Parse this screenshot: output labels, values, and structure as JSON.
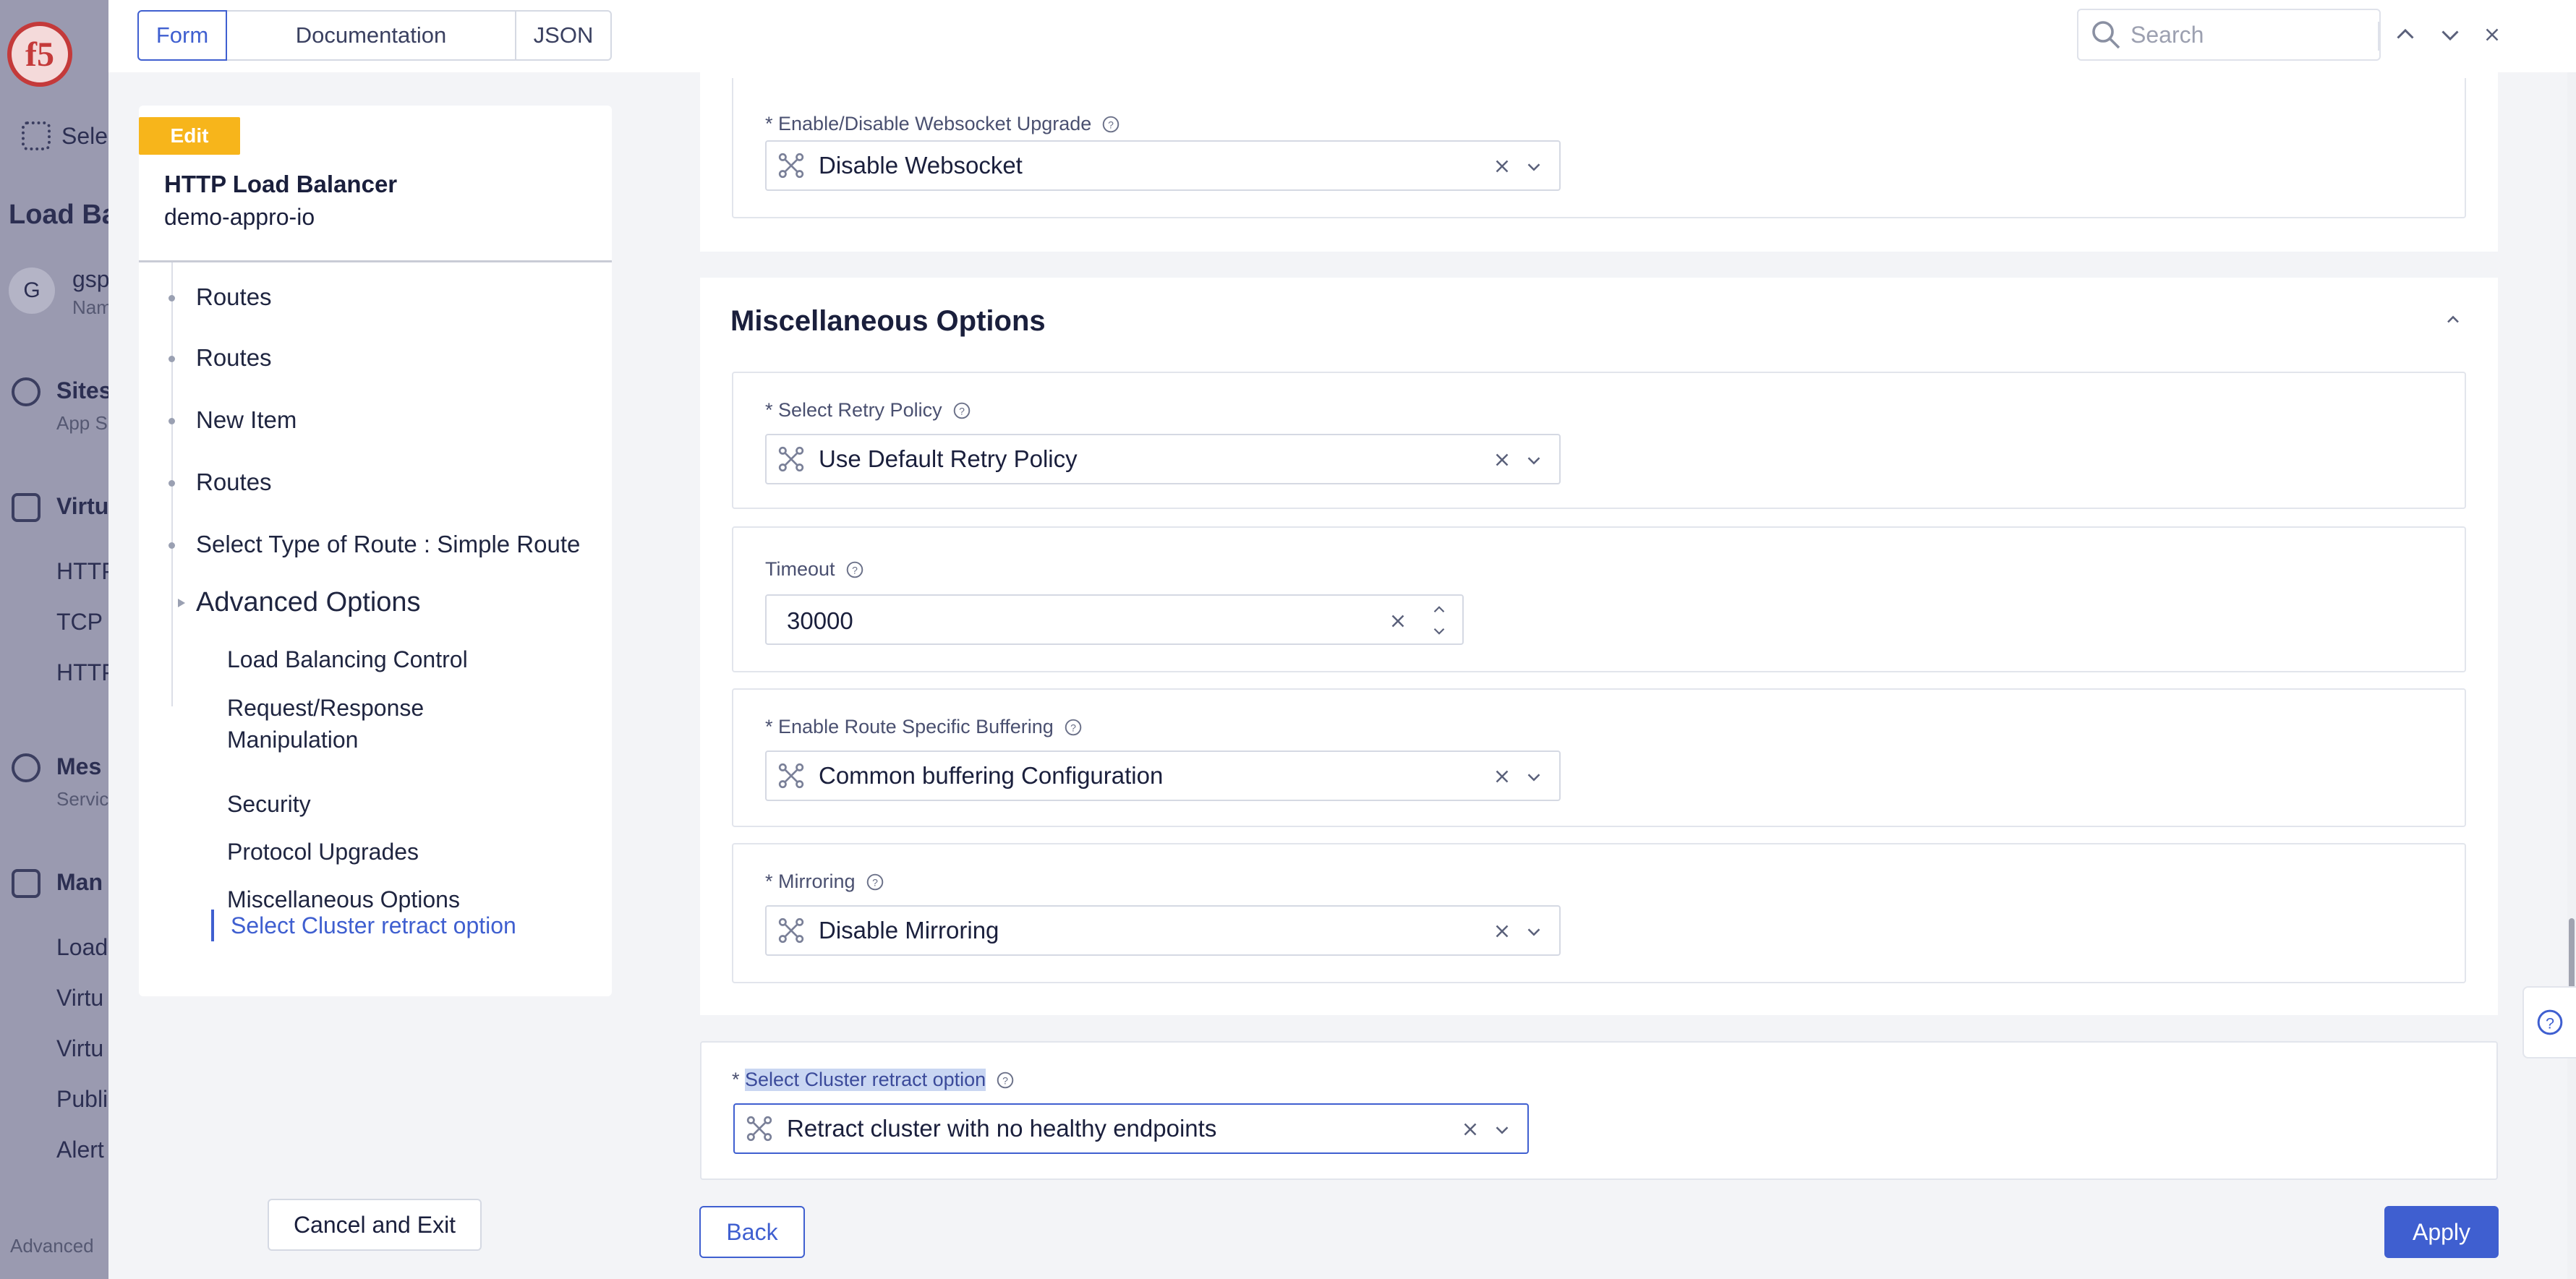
{
  "background": {
    "logo_text": "f5",
    "select_label": "Sele",
    "load_label": "Load Ba",
    "avatar_letter": "G",
    "user_label": "gsp",
    "namespace_label": "Nam",
    "sites_label": "Sites",
    "sites_sub": "App S",
    "virtual_label": "Virtu",
    "http_label": "HTTP",
    "tcp_label": "TCP",
    "https_label": "HTTP",
    "mesh_label": "Mes",
    "mesh_sub": "Servic",
    "manage_label": "Man",
    "load2_label": "Load",
    "virt2_label": "Virtu",
    "virt3_label": "Virtu",
    "public_label": "Publi",
    "alert_label": "Alert",
    "advanced_label": "Advanced"
  },
  "topbar": {
    "tabs": [
      "Form",
      "Documentation",
      "JSON"
    ],
    "search_placeholder": "Search"
  },
  "nav": {
    "badge": "Edit",
    "title": "HTTP Load Balancer",
    "subtitle": "demo-appro-io",
    "tree": [
      "Routes",
      "Routes",
      "New Item",
      "Routes",
      "Select Type of Route : Simple Route",
      "Advanced Options"
    ],
    "sub_items": [
      "Load Balancing Control",
      "Request/Response Manipulation",
      "Security",
      "Protocol Upgrades",
      "Miscellaneous Options",
      "Select Cluster retract option"
    ],
    "cancel_label": "Cancel and Exit"
  },
  "form": {
    "websocket": {
      "label": "* Enable/Disable Websocket Upgrade",
      "value": "Disable Websocket"
    },
    "misc_title": "Miscellaneous Options",
    "retry": {
      "label": "* Select Retry Policy",
      "value": "Use Default Retry Policy"
    },
    "timeout": {
      "label": "Timeout",
      "value": "30000"
    },
    "buffering": {
      "label": "* Enable Route Specific Buffering",
      "value": "Common buffering Configuration"
    },
    "mirroring": {
      "label": "* Mirroring",
      "value": "Disable Mirroring"
    },
    "cluster": {
      "label_prefix": "* ",
      "label": "Select Cluster retract option",
      "value": "Retract cluster with no healthy endpoints"
    },
    "back_label": "Back",
    "apply_label": "Apply"
  },
  "colors": {
    "accent": "#3f5fd0",
    "badge": "#f7b51b",
    "text": "#1a1f3c"
  }
}
